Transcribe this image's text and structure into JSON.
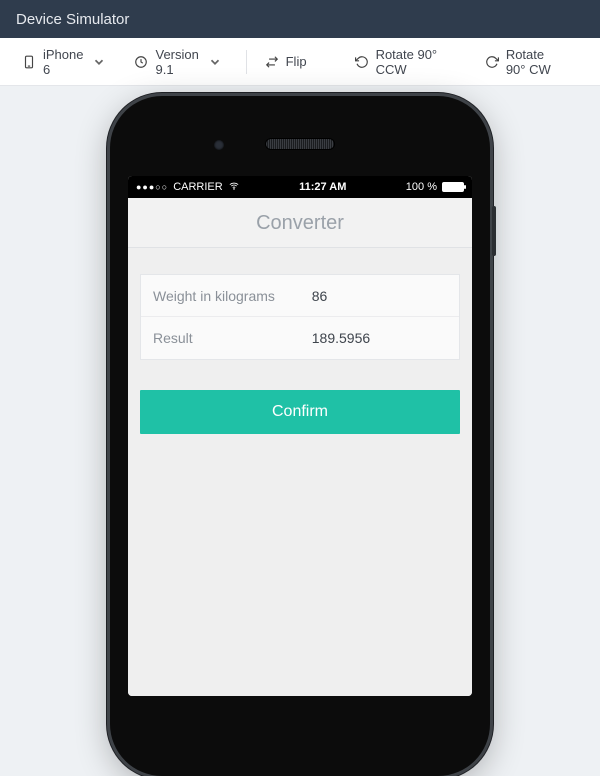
{
  "header": {
    "title": "Device Simulator"
  },
  "toolbar": {
    "device_label": "iPhone 6",
    "version_label": "Version 9.1",
    "flip_label": "Flip",
    "rotate_ccw_label": "Rotate 90° CCW",
    "rotate_cw_label": "Rotate 90° CW"
  },
  "ios_status": {
    "carrier": "CARRIER",
    "time": "11:27 AM",
    "battery_label": "100 %"
  },
  "converter": {
    "title": "Converter",
    "rows": [
      {
        "label": "Weight in kilograms",
        "value": "86"
      },
      {
        "label": "Result",
        "value": "189.5956"
      }
    ],
    "confirm_label": "Confirm"
  },
  "colors": {
    "accent": "#1fc1a6",
    "header": "#2f3c4d"
  }
}
